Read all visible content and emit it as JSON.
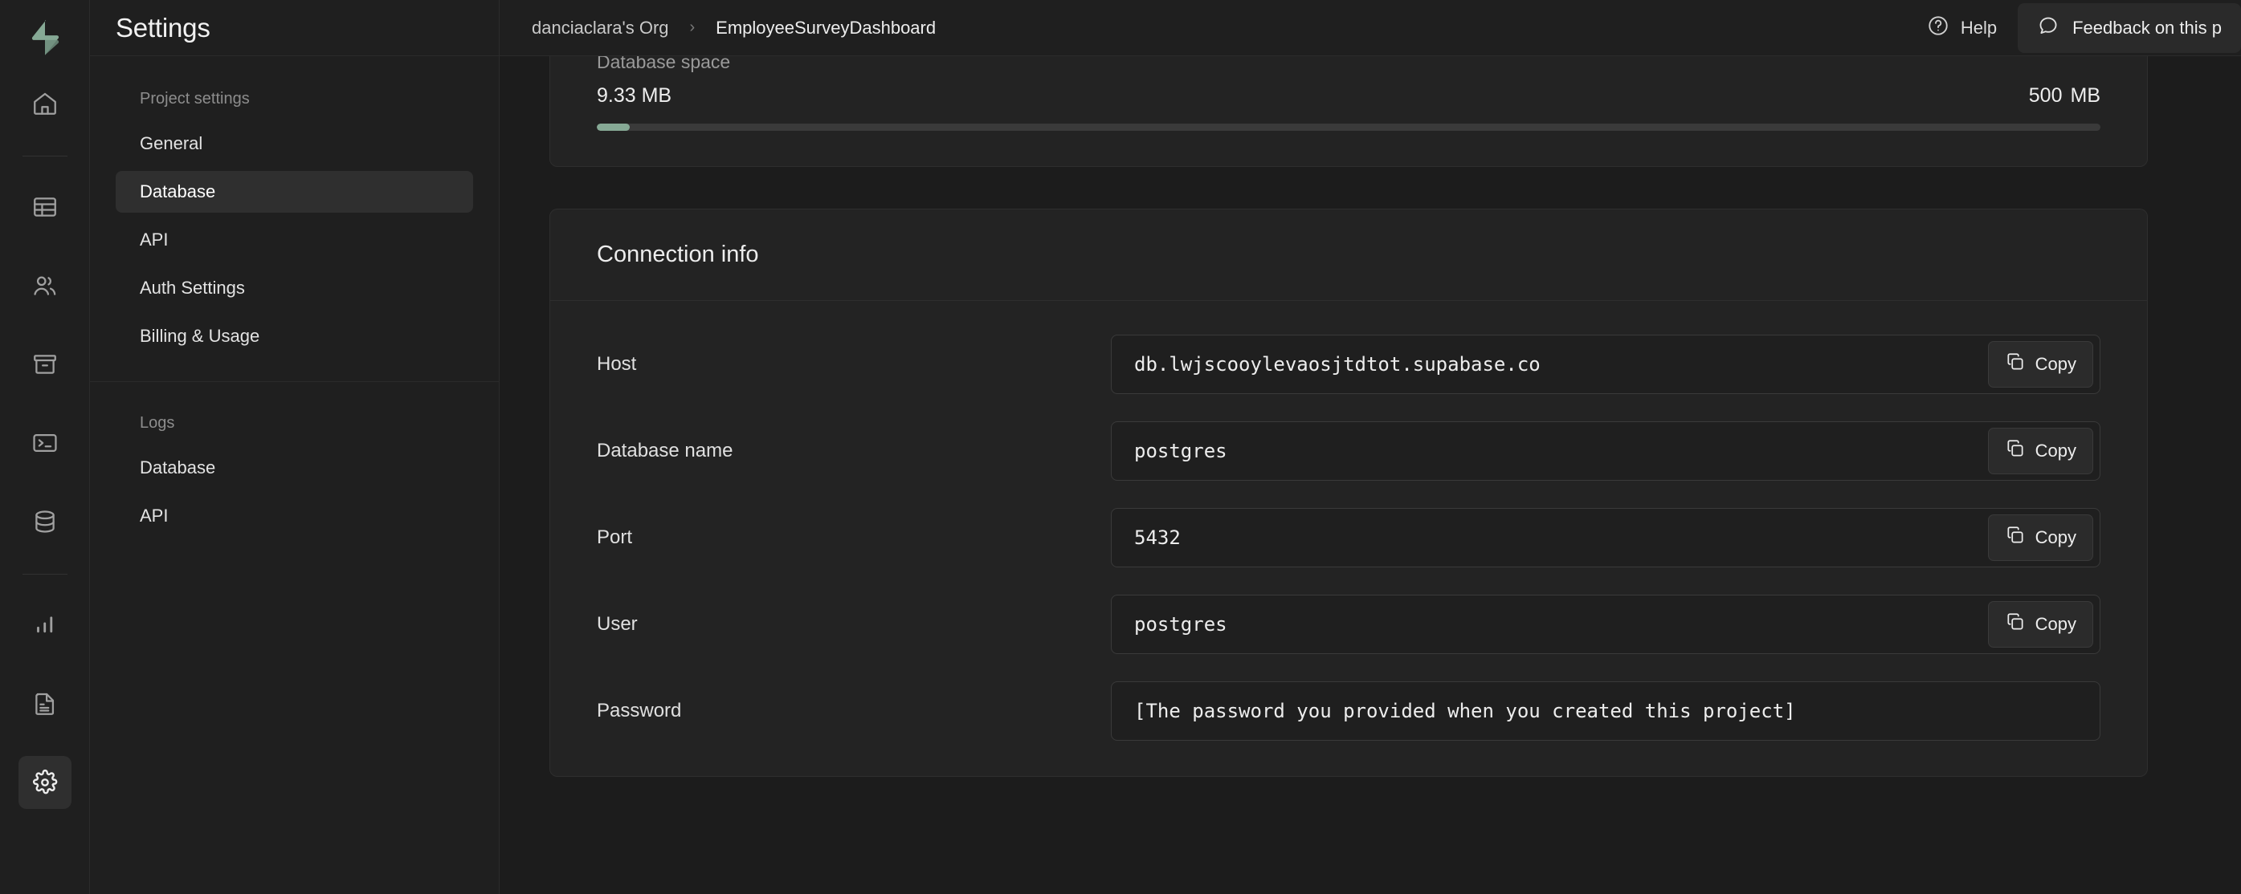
{
  "brand": {
    "logo_name": "supabase-logo",
    "accent": "#86a995"
  },
  "rail": {
    "items": [
      {
        "name": "home-icon",
        "label": "Home"
      },
      {
        "name": "table-editor-icon",
        "label": "Table Editor"
      },
      {
        "name": "authentication-icon",
        "label": "Authentication"
      },
      {
        "name": "storage-icon",
        "label": "Storage"
      },
      {
        "name": "sql-editor-icon",
        "label": "SQL Editor"
      },
      {
        "name": "database-icon",
        "label": "Database"
      },
      {
        "name": "reports-icon",
        "label": "Reports"
      },
      {
        "name": "logs-icon",
        "label": "Logs"
      },
      {
        "name": "settings-icon",
        "label": "Settings"
      }
    ]
  },
  "nav": {
    "title": "Settings",
    "group1_label": "Project settings",
    "group1_items": [
      {
        "label": "General",
        "active": false
      },
      {
        "label": "Database",
        "active": true
      },
      {
        "label": "API",
        "active": false
      },
      {
        "label": "Auth Settings",
        "active": false
      },
      {
        "label": "Billing & Usage",
        "active": false
      }
    ],
    "group2_label": "Logs",
    "group2_items": [
      {
        "label": "Database",
        "active": false
      },
      {
        "label": "API",
        "active": false
      }
    ]
  },
  "topbar": {
    "breadcrumb": {
      "org": "danciaclara's Org",
      "separator": "›",
      "project": "EmployeeSurveyDashboard"
    },
    "help_label": "Help",
    "help_icon": "question-circle-icon",
    "feedback_label": "Feedback on this p",
    "feedback_icon": "chat-bubble-icon"
  },
  "usage": {
    "label": "Database space",
    "used": "9.33 MB",
    "total_value": "500",
    "total_unit": "MB",
    "fill_percent": 2.2,
    "fill_color": "#86a995"
  },
  "connection": {
    "title": "Connection info",
    "copy_label": "Copy",
    "copy_icon": "copy-icon",
    "fields": [
      {
        "label": "Host",
        "value": "db.lwjscooylevaosjtdtot.supabase.co",
        "copyable": true
      },
      {
        "label": "Database name",
        "value": "postgres",
        "copyable": true
      },
      {
        "label": "Port",
        "value": "5432",
        "copyable": true
      },
      {
        "label": "User",
        "value": "postgres",
        "copyable": true
      },
      {
        "label": "Password",
        "value": "[The password you provided when you created this project]",
        "copyable": false
      }
    ]
  }
}
